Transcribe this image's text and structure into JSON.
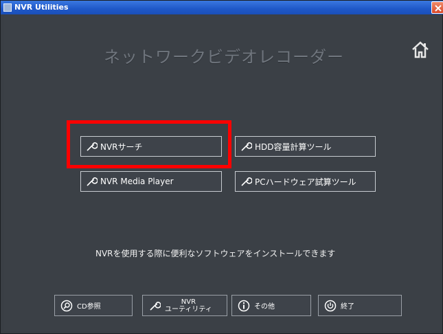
{
  "window": {
    "title": "NVR Utilities"
  },
  "header": {
    "headline": "ネットワークビデオレコーダー",
    "home_icon": "home-icon"
  },
  "tools": [
    {
      "label": "NVRサーチ",
      "icon": "wrench-icon"
    },
    {
      "label": "HDD容量計算ツール",
      "icon": "wrench-icon"
    },
    {
      "label": "NVR Media Player",
      "icon": "wrench-icon"
    },
    {
      "label": "PCハードウェア試算ツール",
      "icon": "wrench-icon"
    }
  ],
  "info_text": "NVRを使用する際に便利なソフトウェアをインストールできます",
  "bottom": {
    "cd": {
      "label": "CD参照",
      "icon": "search-icon"
    },
    "nvr": {
      "top": "NVR",
      "bottom": "ユーティリティ",
      "icon": "wrench-icon"
    },
    "other": {
      "label": "その他",
      "icon": "info-icon"
    },
    "exit": {
      "label": "終了",
      "icon": "power-icon"
    }
  },
  "colors": {
    "highlight": "#ff0000",
    "titlebar": "#1f58c8",
    "background": "#3b4046"
  }
}
